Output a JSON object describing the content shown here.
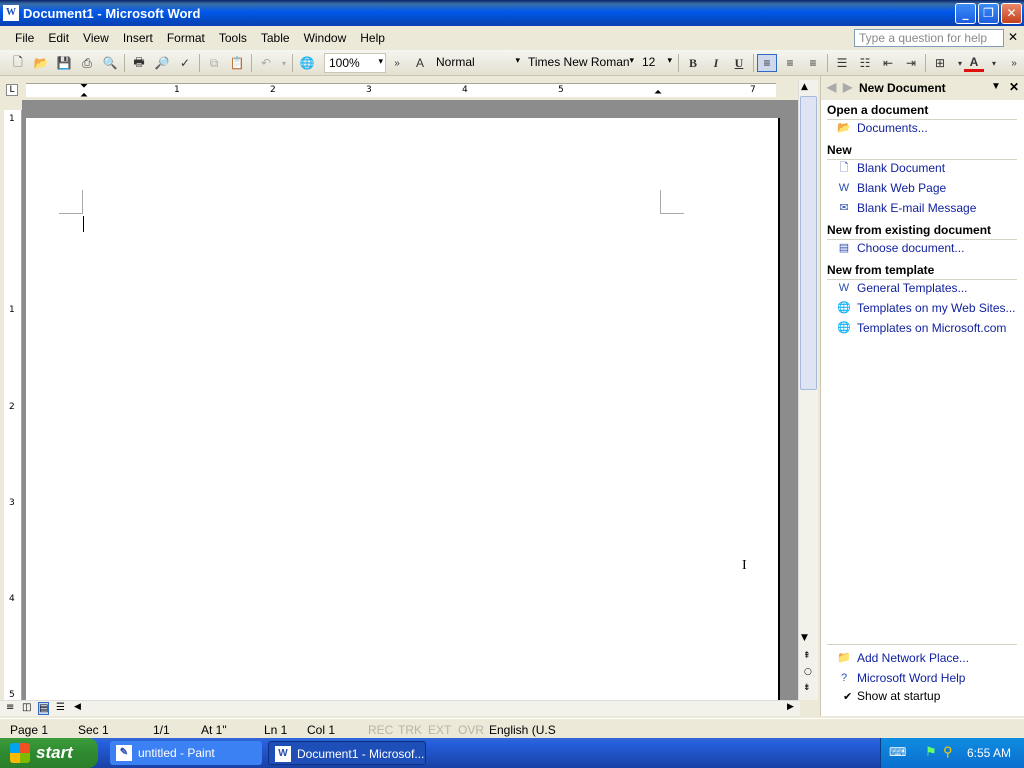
{
  "window": {
    "title": "Document1 - Microsoft Word",
    "app_icon": "word-icon"
  },
  "menu": [
    "File",
    "Edit",
    "View",
    "Insert",
    "Format",
    "Tools",
    "Table",
    "Window",
    "Help"
  ],
  "ask_placeholder": "Type a question for help",
  "toolbar": {
    "zoom": "100%",
    "style": "Normal",
    "font": "Times New Roman",
    "size": "12",
    "bold": "B",
    "italic": "I",
    "underline": "U",
    "font_color_letter": "A"
  },
  "ruler_numbers": [
    "1",
    "2",
    "3",
    "4",
    "5",
    "7"
  ],
  "vruler_numbers": [
    "1",
    "1",
    "2",
    "3",
    "4",
    "5"
  ],
  "taskpane": {
    "title": "New Document",
    "sections": {
      "open": "Open a document",
      "new": "New",
      "existing": "New from existing document",
      "template": "New from template"
    },
    "links": {
      "documents": "Documents...",
      "blank_document": "Blank Document",
      "blank_web": "Blank Web Page",
      "blank_email": "Blank E-mail Message",
      "choose_document": "Choose document...",
      "general_templates": "General Templates...",
      "web_templates": "Templates on my Web Sites...",
      "ms_templates": "Templates on Microsoft.com",
      "network_place": "Add Network Place...",
      "word_help": "Microsoft Word Help"
    },
    "show_at_startup": "Show at startup",
    "show_at_startup_checked": true
  },
  "status": {
    "page": "Page 1",
    "sec": "Sec 1",
    "pages": "1/1",
    "at": "At 1\"",
    "ln": "Ln 1",
    "col": "Col 1",
    "rec": "REC",
    "trk": "TRK",
    "ext": "EXT",
    "ovr": "OVR",
    "lang": "English (U.S"
  },
  "taskbar": {
    "start": "start",
    "tasks": [
      "untitled - Paint",
      "Document1 - Microsof..."
    ],
    "clock": "6:55 AM"
  },
  "colors": {
    "title_blue": "#0058ee",
    "link_blue": "#0f1f9d",
    "start_green": "#2f8a2f",
    "font_color_red": "#e01010"
  }
}
